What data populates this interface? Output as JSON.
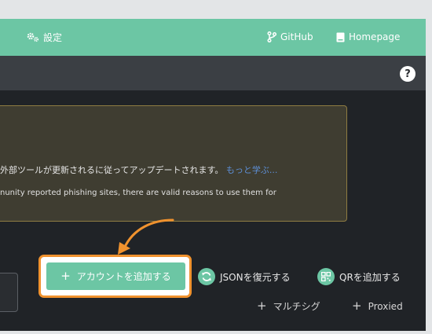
{
  "navbar": {
    "settings_label": "設定",
    "github_label": "GitHub",
    "homepage_label": "Homepage",
    "settings_icon": "gears-icon",
    "github_icon": "branch-icon",
    "homepage_icon": "book-icon"
  },
  "subbar": {
    "help_label": "?"
  },
  "warning": {
    "line1_text": "外部ツールが更新されるに従ってアップデートされます。",
    "line1_link": "もっと学ぶ...",
    "line2_text": "nunity reported phishing sites, there are valid reasons to use them for"
  },
  "actions": {
    "add_account_label": "アカウントを追加する",
    "restore_json_label": "JSONを復元する",
    "add_qr_label": "QRを追加する",
    "multisig_label": "マルチシグ",
    "proxied_label": "Proxied",
    "plus": "+"
  },
  "colors": {
    "accent": "#6cc6a4",
    "highlight": "#f0922e",
    "background": "#202327",
    "warning_bg": "#3f3d31",
    "warning_border": "#8f7c42",
    "link": "#5d8fd6"
  }
}
